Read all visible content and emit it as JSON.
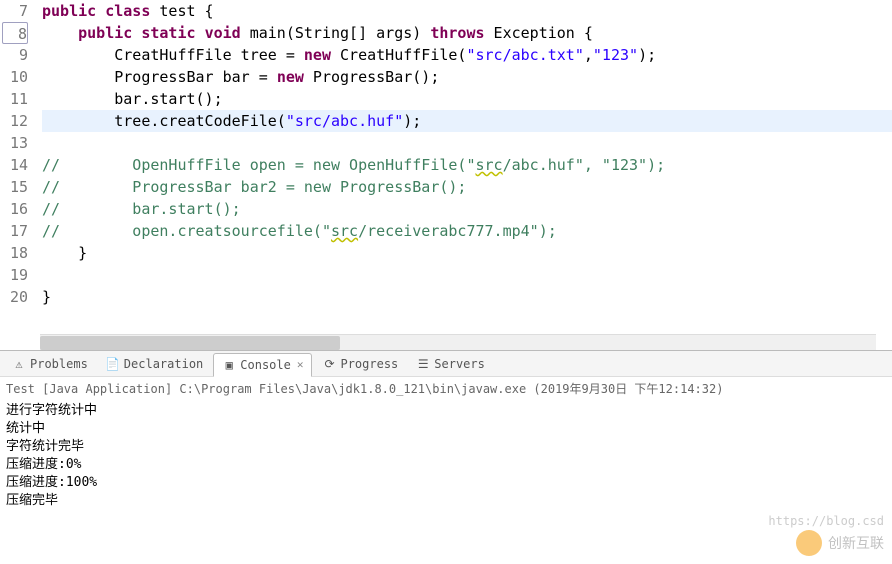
{
  "code": {
    "lines": [
      {
        "num": 7,
        "tokens": [
          {
            "cls": "kw",
            "t": "public"
          },
          {
            "cls": "txt",
            "t": " "
          },
          {
            "cls": "kw",
            "t": "class"
          },
          {
            "cls": "txt",
            "t": " test {"
          }
        ]
      },
      {
        "num": 8,
        "boxed": true,
        "indent": 1,
        "tokens": [
          {
            "cls": "kw",
            "t": "public"
          },
          {
            "cls": "txt",
            "t": " "
          },
          {
            "cls": "kw",
            "t": "static"
          },
          {
            "cls": "txt",
            "t": " "
          },
          {
            "cls": "kw",
            "t": "void"
          },
          {
            "cls": "txt",
            "t": " main(String[] args) "
          },
          {
            "cls": "kw",
            "t": "throws"
          },
          {
            "cls": "txt",
            "t": " Exception {"
          }
        ]
      },
      {
        "num": 9,
        "indent": 2,
        "tokens": [
          {
            "cls": "txt",
            "t": "CreatHuffFile tree = "
          },
          {
            "cls": "kw",
            "t": "new"
          },
          {
            "cls": "txt",
            "t": " CreatHuffFile("
          },
          {
            "cls": "str",
            "t": "\"src/abc.txt\""
          },
          {
            "cls": "txt",
            "t": ","
          },
          {
            "cls": "str",
            "t": "\"123\""
          },
          {
            "cls": "txt",
            "t": ");"
          }
        ]
      },
      {
        "num": 10,
        "indent": 2,
        "tokens": [
          {
            "cls": "txt",
            "t": "ProgressBar bar = "
          },
          {
            "cls": "kw",
            "t": "new"
          },
          {
            "cls": "txt",
            "t": " ProgressBar();"
          }
        ]
      },
      {
        "num": 11,
        "indent": 2,
        "tokens": [
          {
            "cls": "txt",
            "t": "bar.start();"
          }
        ]
      },
      {
        "num": 12,
        "highlighted": true,
        "indent": 2,
        "tokens": [
          {
            "cls": "txt",
            "t": "tree.creatCodeFile("
          },
          {
            "cls": "str",
            "t": "\"src/abc.huf\""
          },
          {
            "cls": "txt",
            "t": ");"
          }
        ]
      },
      {
        "num": 13,
        "tokens": []
      },
      {
        "num": 14,
        "tokens": [
          {
            "cls": "cmt",
            "t": "//        OpenHuffFile open = new OpenHuffFile(\""
          },
          {
            "cls": "cmt err",
            "t": "src"
          },
          {
            "cls": "cmt",
            "t": "/abc.huf\", \"123\");"
          }
        ]
      },
      {
        "num": 15,
        "tokens": [
          {
            "cls": "cmt",
            "t": "//        ProgressBar bar2 = new ProgressBar();"
          }
        ]
      },
      {
        "num": 16,
        "tokens": [
          {
            "cls": "cmt",
            "t": "//        bar.start();"
          }
        ]
      },
      {
        "num": 17,
        "tokens": [
          {
            "cls": "cmt",
            "t": "//        open.creatsourcefile(\""
          },
          {
            "cls": "cmt err",
            "t": "src"
          },
          {
            "cls": "cmt",
            "t": "/receiverabc777.mp4\");"
          }
        ]
      },
      {
        "num": 18,
        "indent": 1,
        "tokens": [
          {
            "cls": "txt",
            "t": "}"
          }
        ]
      },
      {
        "num": 19,
        "tokens": []
      },
      {
        "num": 20,
        "tokens": [
          {
            "cls": "txt",
            "t": "}"
          }
        ]
      }
    ]
  },
  "tabs": {
    "items": [
      {
        "label": "Problems",
        "icon": "problems-icon"
      },
      {
        "label": "Declaration",
        "icon": "declaration-icon"
      },
      {
        "label": "Console",
        "icon": "console-icon",
        "active": true,
        "closable": true
      },
      {
        "label": "Progress",
        "icon": "progress-icon"
      },
      {
        "label": "Servers",
        "icon": "servers-icon"
      }
    ]
  },
  "console": {
    "header": "Test [Java Application] C:\\Program Files\\Java\\jdk1.8.0_121\\bin\\javaw.exe (2019年9月30日 下午12:14:32)",
    "lines": [
      "进行字符统计中",
      "统计中",
      "字符统计完毕",
      "压缩进度:0%",
      "压缩进度:100%",
      "压缩完毕"
    ]
  },
  "watermark": {
    "text": "创新互联",
    "url": "https://blog.csd"
  }
}
